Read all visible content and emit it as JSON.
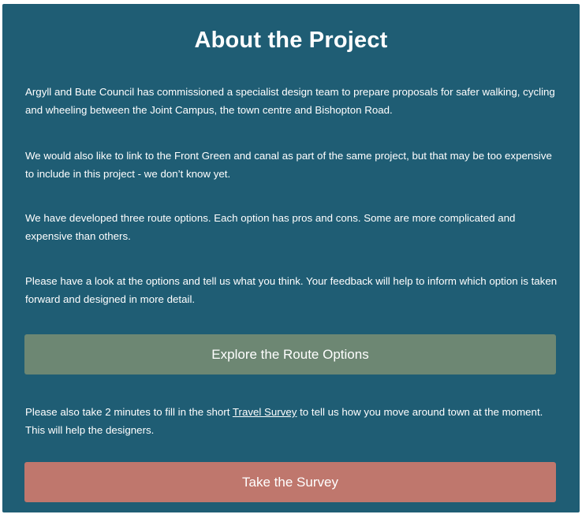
{
  "section": {
    "title": "About the Project",
    "paragraph1": "Argyll and Bute Council has commissioned a specialist design team to prepare proposals for safer walking, cycling and wheeling between the Joint Campus, the town centre and Bishopton Road.",
    "paragraph2": "We would also like to link to the Front Green and canal as part of the same project, but that may be too expensive to include in this project - we don’t know yet.",
    "paragraph3": "We have developed three route options. Each option has pros and cons. Some are more complicated and expensive than others.",
    "paragraph4": "Please have a look at the options and tell us what you think. Your feedback will help to inform which option is taken forward and designed in more detail.",
    "explore_button": "Explore the Route Options",
    "survey_text_before": "Please also take 2 minutes to fill in the short ",
    "survey_link": "Travel Survey",
    "survey_text_after": " to tell us how you move around town at the moment. This will help the designers.",
    "survey_button": "Take the Survey"
  },
  "colors": {
    "panel_background": "#1f5d74",
    "explore_button": "#6d8773",
    "survey_button": "#bf776d",
    "text": "#ffffff"
  }
}
